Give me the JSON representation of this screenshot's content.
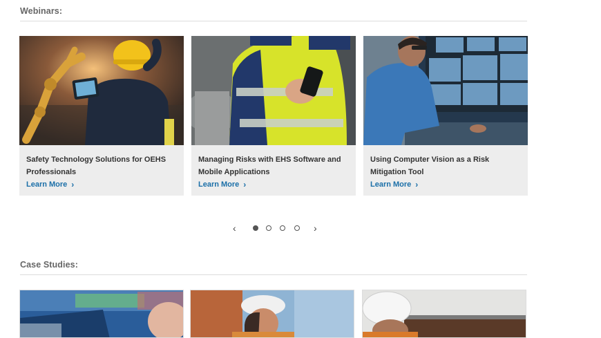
{
  "webinars": {
    "heading": "Webinars:",
    "cards": [
      {
        "title": "Safety Technology Solutions for OEHS Professionals",
        "link": "Learn More",
        "image_icon": "robot-arm-worker-photo"
      },
      {
        "title": "Managing Risks with EHS Software and Mobile Applications",
        "link": "Learn More",
        "image_icon": "hi-vis-worker-phone-photo"
      },
      {
        "title": "Using Computer Vision as a Risk Mitigation Tool",
        "link": "Learn More",
        "image_icon": "monitoring-screens-photo"
      }
    ],
    "carousel": {
      "pages": 4,
      "current": 1,
      "prev_icon": "chevron-left-icon",
      "next_icon": "chevron-right-icon"
    }
  },
  "case_studies": {
    "heading": "Case Studies:"
  },
  "colors": {
    "link": "#1b6fa8",
    "card_bg": "#ededed",
    "heading": "#666666"
  }
}
